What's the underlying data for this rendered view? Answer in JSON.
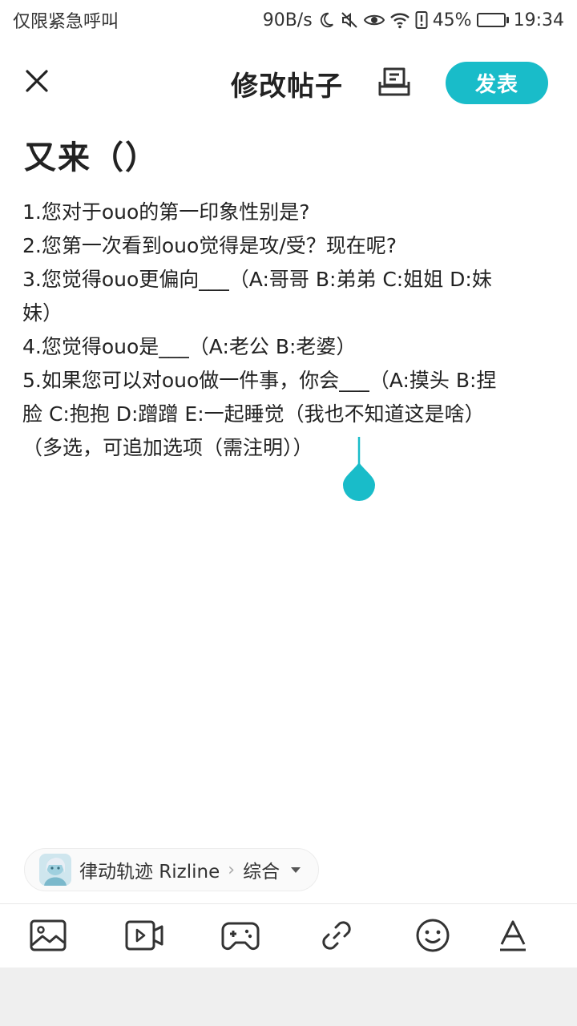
{
  "status_bar": {
    "carrier_text": "仅限紧急呼叫",
    "net_speed": "90B/s",
    "battery_percent": "45%",
    "battery_level": 0.45,
    "time": "19:34",
    "icons": [
      "moon-icon",
      "mute-icon",
      "eye-icon",
      "wifi-icon",
      "alert-icon",
      "battery-icon"
    ]
  },
  "header": {
    "close_icon": "close-icon",
    "title": "修改帖子",
    "drafts_icon": "drafts-icon",
    "publish_label": "发表"
  },
  "post": {
    "title": "又来（）",
    "lines": [
      "1.您对于ouo的第一印象性别是?",
      "2.您第一次看到ouo觉得是攻/受？现在呢?",
      "3.您觉得ouo更偏向___（A:哥哥 B:弟弟 C:姐姐 D:妹",
      "妹）",
      "4.您觉得ouo是___（A:老公 B:老婆）",
      "5.如果您可以对ouo做一件事，你会___（A:摸头 B:捏",
      "脸 C:抱抱 D:蹭蹭 E:一起睡觉（我也不知道这是啥）",
      "（多选，可追加选项（需注明））"
    ]
  },
  "topic": {
    "game_name": "律动轨迹 Rizline",
    "separator": "›",
    "category": "综合"
  },
  "toolbar": {
    "items": [
      "image-icon",
      "video-icon",
      "game-icon",
      "link-icon",
      "emoji-icon",
      "text-format-icon"
    ]
  },
  "colors": {
    "accent": "#19bcc9",
    "battery_green": "#3bb54a"
  }
}
